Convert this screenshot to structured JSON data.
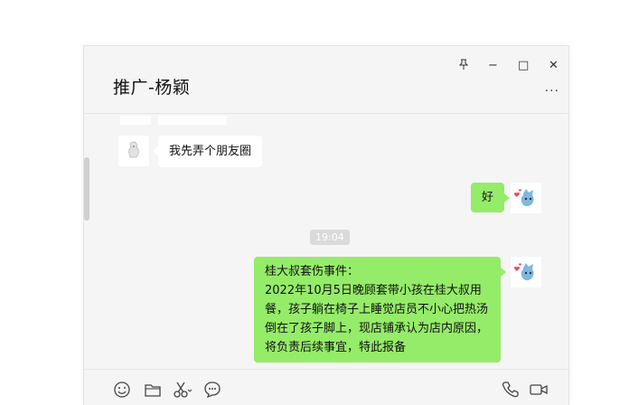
{
  "window": {
    "title": "推广-杨颖",
    "controls": {
      "pin": "⊥",
      "minimize": "−",
      "maximize": "□",
      "close": "✕"
    },
    "more": "···"
  },
  "chat": {
    "messages": [
      {
        "side": "in",
        "text": "我先弄个朋友圈"
      },
      {
        "side": "out",
        "text": "好"
      },
      {
        "side": "out",
        "text": "桂大叔套伤事件：\n2022年10月5日晚顾套带小孩在桂大叔用餐，孩子躺在椅子上睡觉店员不小心把热汤倒在了孩子脚上，现店铺承认为店内原因，将负责后续事宜，特此报备"
      }
    ],
    "timestamp": "19:04"
  },
  "toolbar": {
    "icons": [
      "emoji-icon",
      "folder-icon",
      "scissors-icon",
      "chat-history-icon",
      "phone-icon",
      "video-icon"
    ]
  },
  "colors": {
    "outgoing_bubble": "#95ec69",
    "incoming_bubble": "#ffffff",
    "window_bg": "#f5f5f5"
  }
}
